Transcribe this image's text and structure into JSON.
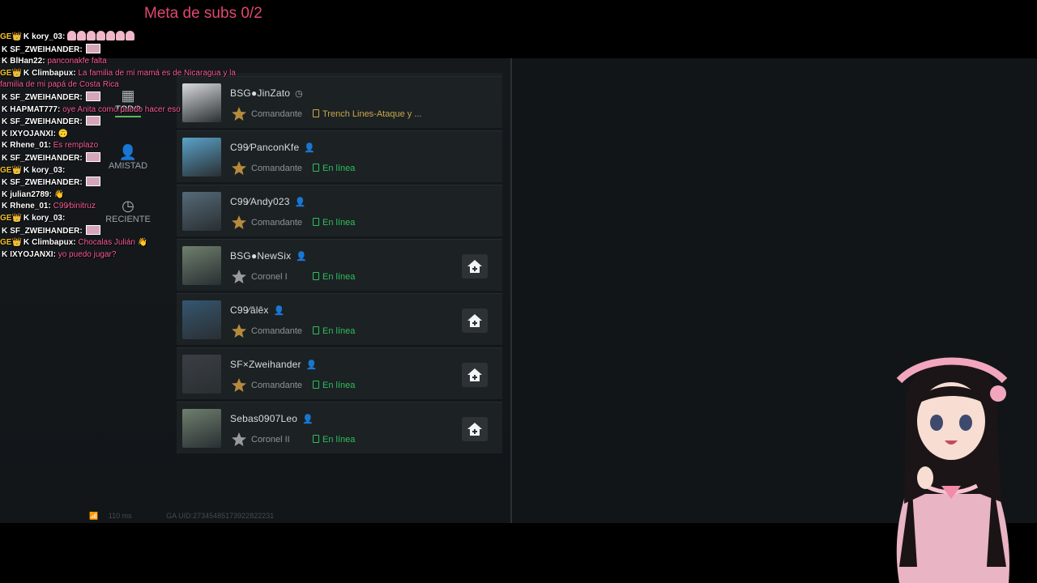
{
  "overlay": {
    "goal_text": "Meta de subs 0/2"
  },
  "chat": [
    {
      "user": "kory_03",
      "msg": "",
      "emote": "ghosts",
      "badges": "GE👑"
    },
    {
      "user": "SF_ZWEIHANDER",
      "msg": "",
      "emote": "pic",
      "badges": ""
    },
    {
      "user": "BlHan22",
      "msg": "panconakfe falta",
      "emote": "",
      "badges": ""
    },
    {
      "user": "Climbapux",
      "msg": "La familia de mi mamá es de Nicaragua y la",
      "emote": "",
      "badges": "GE👑"
    },
    {
      "user": "",
      "msg": "familia de mi papá de Costa Rica",
      "emote": "",
      "badges": "",
      "continuation": true
    },
    {
      "user": "SF_ZWEIHANDER",
      "msg": "",
      "emote": "pic",
      "badges": ""
    },
    {
      "user": "HAPMAT777",
      "msg": "oye Anita como puedo hacer eso",
      "emote": "",
      "badges": ""
    },
    {
      "user": "SF_ZWEIHANDER",
      "msg": "",
      "emote": "pic",
      "badges": ""
    },
    {
      "user": "IXYOJANXI",
      "msg": "🙃",
      "emote": "",
      "badges": ""
    },
    {
      "user": "Rhene_01",
      "msg": "Es remplazo",
      "emote": "",
      "badges": ""
    },
    {
      "user": "SF_ZWEIHANDER",
      "msg": "",
      "emote": "pic",
      "badges": ""
    },
    {
      "user": "kory_03",
      "msg": "",
      "emote": "",
      "badges": "GE👑"
    },
    {
      "user": "SF_ZWEIHANDER",
      "msg": "",
      "emote": "pic",
      "badges": ""
    },
    {
      "user": "julian2789",
      "msg": "👋",
      "emote": "",
      "badges": ""
    },
    {
      "user": "Rhene_01",
      "msg": "C99⁄binitruz",
      "emote": "",
      "badges": ""
    },
    {
      "user": "kory_03",
      "msg": "",
      "emote": "",
      "badges": "GE👑"
    },
    {
      "user": "SF_ZWEIHANDER",
      "msg": "",
      "emote": "pic",
      "badges": ""
    },
    {
      "user": "Climbapux",
      "msg": "Chocalas Julián 👋",
      "emote": "",
      "badges": "GE👑"
    },
    {
      "user": "IXYOJANXI",
      "msg": "yo puedo jugar?",
      "emote": "",
      "badges": ""
    }
  ],
  "nav": {
    "tab_all": "TODO",
    "tab_friends": "AMISTAD",
    "tab_recent": "RECIENTE"
  },
  "friends": [
    {
      "name": "BSG●JinZato",
      "rank": "Comandante",
      "status": "Trench Lines-Ataque y ...",
      "playing": true,
      "join": false
    },
    {
      "name": "C99⁄PanconKfe",
      "rank": "Comandante",
      "status": "En línea",
      "playing": false,
      "join": false
    },
    {
      "name": "C99⁄Andy023",
      "rank": "Comandante",
      "status": "En línea",
      "playing": false,
      "join": false
    },
    {
      "name": "BSG●NewSix",
      "rank": "Coronel I",
      "status": "En línea",
      "playing": false,
      "join": true
    },
    {
      "name": "C99⁄âlêx",
      "rank": "Comandante",
      "status": "En línea",
      "playing": false,
      "join": true
    },
    {
      "name": "SF×Zweihander",
      "rank": "Comandante",
      "status": "En línea",
      "playing": false,
      "join": true
    },
    {
      "name": "Sebas0907Leo",
      "rank": "Coronel II",
      "status": "En línea",
      "playing": false,
      "join": true
    }
  ],
  "footer": {
    "ping": "110 ms",
    "uid": "GA UID:27345485173922822231"
  },
  "colors": {
    "online": "#2fbf5a",
    "playing": "#c9a84a",
    "goal": "#e0486e",
    "chat_msg": "#ff5fa0"
  }
}
